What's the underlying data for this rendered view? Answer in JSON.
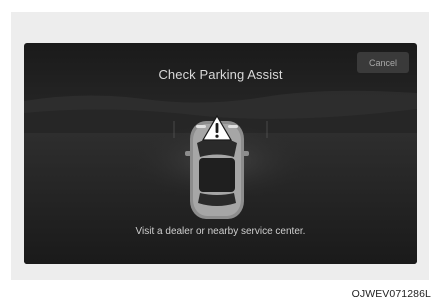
{
  "screen": {
    "title": "Check Parking Assist",
    "cancel_label": "Cancel",
    "message": "Visit a dealer or nearby service center."
  },
  "figure": {
    "code": "OJWEV071286L"
  },
  "icons": {
    "vehicle": "car-top-view-icon",
    "warning": "warning-triangle-icon"
  },
  "colors": {
    "screen_background": "#242424",
    "text": "#d9d9d9",
    "button_background": "#3a3a3a"
  }
}
